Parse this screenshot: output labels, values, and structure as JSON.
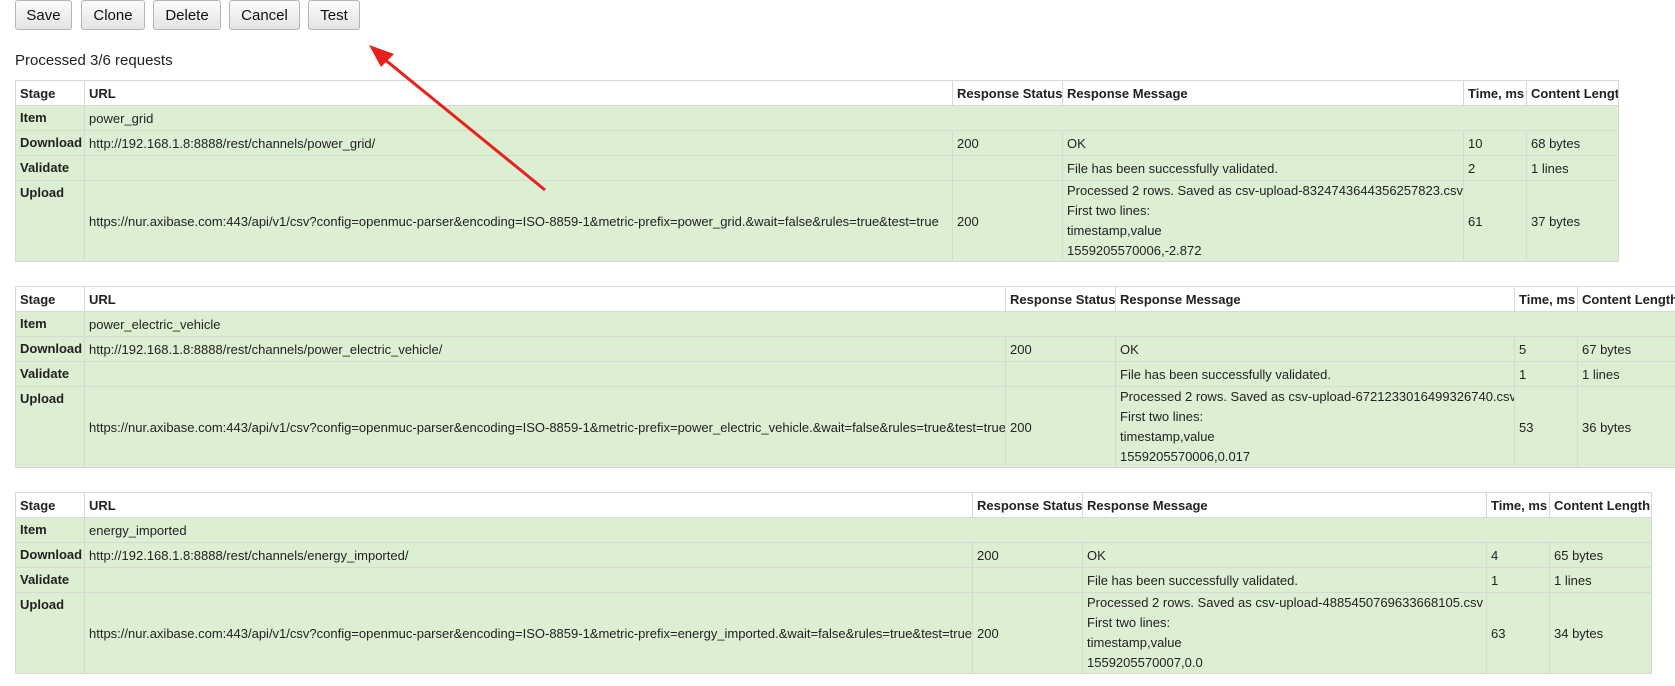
{
  "toolbar": {
    "save": "Save",
    "clone": "Clone",
    "delete": "Delete",
    "cancel": "Cancel",
    "test": "Test"
  },
  "summary": "Processed 3/6 requests",
  "annotation": {
    "arrow_color": "#e8211d"
  },
  "colors": {
    "row_background": "#dcefd3",
    "header_background": "#ffffff"
  },
  "columns": [
    "Stage",
    "URL",
    "Response Status",
    "Response Message",
    "Time, ms",
    "Content Length"
  ],
  "tables": [
    {
      "item_label": "Item",
      "item": "power_grid",
      "download": {
        "stage": "Download",
        "url": "http://192.168.1.8:8888/rest/channels/power_grid/",
        "status": "200",
        "message": "OK",
        "time": "10",
        "length": "68 bytes"
      },
      "validate": {
        "stage": "Validate",
        "url": "",
        "status": "",
        "message": "File has been successfully validated.",
        "time": "2",
        "length": "1 lines"
      },
      "upload": {
        "stage": "Upload",
        "url": "https://nur.axibase.com:443/api/v1/csv?config=openmuc-parser&encoding=ISO-8859-1&metric-prefix=power_grid.&wait=false&rules=true&test=true",
        "status": "200",
        "message_lines": [
          "Processed 2 rows. Saved as csv-upload-8324743644356257823.csv",
          "First two lines:",
          "timestamp,value",
          "1559205570006,-2.872"
        ],
        "time": "61",
        "length": "37 bytes"
      }
    },
    {
      "item_label": "Item",
      "item": "power_electric_vehicle",
      "download": {
        "stage": "Download",
        "url": "http://192.168.1.8:8888/rest/channels/power_electric_vehicle/",
        "status": "200",
        "message": "OK",
        "time": "5",
        "length": "67 bytes"
      },
      "validate": {
        "stage": "Validate",
        "url": "",
        "status": "",
        "message": "File has been successfully validated.",
        "time": "1",
        "length": "1 lines"
      },
      "upload": {
        "stage": "Upload",
        "url": "https://nur.axibase.com:443/api/v1/csv?config=openmuc-parser&encoding=ISO-8859-1&metric-prefix=power_electric_vehicle.&wait=false&rules=true&test=true",
        "status": "200",
        "message_lines": [
          "Processed 2 rows. Saved as csv-upload-6721233016499326740.csv",
          "First two lines:",
          "timestamp,value",
          "1559205570006,0.017"
        ],
        "time": "53",
        "length": "36 bytes"
      }
    },
    {
      "item_label": "Item",
      "item": "energy_imported",
      "download": {
        "stage": "Download",
        "url": "http://192.168.1.8:8888/rest/channels/energy_imported/",
        "status": "200",
        "message": "OK",
        "time": "4",
        "length": "65 bytes"
      },
      "validate": {
        "stage": "Validate",
        "url": "",
        "status": "",
        "message": "File has been successfully validated.",
        "time": "1",
        "length": "1 lines"
      },
      "upload": {
        "stage": "Upload",
        "url": "https://nur.axibase.com:443/api/v1/csv?config=openmuc-parser&encoding=ISO-8859-1&metric-prefix=energy_imported.&wait=false&rules=true&test=true",
        "status": "200",
        "message_lines": [
          "Processed 2 rows. Saved as csv-upload-4885450769633668105.csv",
          "First two lines:",
          "timestamp,value",
          "1559205570007,0.0"
        ],
        "time": "63",
        "length": "34 bytes"
      }
    }
  ]
}
